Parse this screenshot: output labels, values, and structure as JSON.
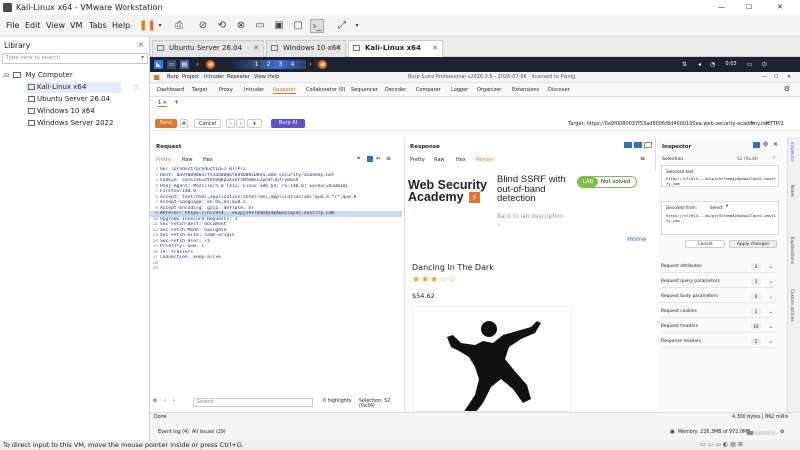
{
  "window": {
    "title": "Kali-Linux x64 - VMware Workstation",
    "minimize": "—",
    "maximize": "☐",
    "close": "✕"
  },
  "menu": [
    "File",
    "Edit",
    "View",
    "VM",
    "Tabs",
    "Help"
  ],
  "library": {
    "title": "Library",
    "close": "✕",
    "search_placeholder": "Type here to search",
    "root": "My Computer",
    "items": [
      "Kali-Linux x64",
      "Ubuntu Server 26.04",
      "Windows 10 x64",
      "Windows Server 2022"
    ]
  },
  "vm_tabs": [
    {
      "label": "Ubuntu Server 26.04"
    },
    {
      "label": "Windows 10 x64"
    },
    {
      "label": "Kali-Linux x64"
    }
  ],
  "kali": {
    "workspaces": [
      "1",
      "2",
      "3",
      "4"
    ],
    "time": "0:03"
  },
  "burp": {
    "title": "Burp Suite Professional v2026.3.5 - 2026-07-06 - licensed to Pwnlg",
    "menu": [
      "Burp",
      "Project",
      "Intruder",
      "Repeater",
      "View",
      "Help"
    ],
    "tabs": [
      "Dashboard",
      "Target",
      "Proxy",
      "Intruder",
      "Repeater",
      "Collaborator (0)",
      "Sequencer",
      "Decoder",
      "Comparer",
      "Logger",
      "Organizer",
      "Extensions",
      "Discover"
    ],
    "subtab": "1 ×",
    "send": "Send",
    "cancel": "Cancel",
    "burpai": "Burp AI",
    "target": "Target: https://0a9f0080037f53ad8006f8d4000100ea.web-security-academy.net",
    "http": "HTTP/2",
    "request": {
      "title": "Request",
      "tabs": [
        "Pretty",
        "Raw",
        "Hex"
      ],
      "lines": [
        "GET /product?productId=1 HTTP/2",
        "Host: 0a9f0080037f53ad8006f8d4000100ea.web-security-academy.net",
        "Cookie: session=4tVX9qKpuXxSt5NtmWsGJpn4t3QTryp6vA",
        "User-Agent: Mozilla/5.0 (X11; Linux x86_64; rv:140.0) Gecko/20100101",
        "Firefox/140.0",
        "Accept: text/html,application/xhtml+xml,application/xml;q=0.9,*/*;q=0.8",
        "Accept-Language: en-US,en;q=0.5",
        "Accept-Encoding: gzip, deflate, br",
        "Referer: https://nlc9l4...ok2pjs9z7dnm4y4pAwuZlqcei.oastify.com",
        "Upgrade-Insecure-Requests: 1",
        "Sec-Fetch-Dest: document",
        "Sec-Fetch-Mode: navigate",
        "Sec-Fetch-Site: same-origin",
        "Sec-Fetch-User: ?1",
        "Priority: u=0, i",
        "Te: trailers",
        "Connection: keep-alive",
        "",
        ""
      ],
      "search_placeholder": "Search",
      "highlights": "0 highlights",
      "selection": "Selection: 52 (0x34)"
    },
    "response": {
      "title": "Response",
      "tabs": [
        "Pretty",
        "Raw",
        "Hex",
        "Render"
      ],
      "wsa_logo": [
        "Web Security",
        "Academy"
      ],
      "lab_title": "Blind SSRF with out-of-band detection",
      "lab_badge": "LAB",
      "lab_status": "Not solved",
      "back_link": "Back to lab description",
      "home": "Home",
      "product_title": "Dancing In The Dark",
      "price": "$54.62",
      "stars": "★★★☆☆"
    },
    "inspector": {
      "title": "Inspector",
      "selection_label": "Selection",
      "selection_count": "52 (0x34)",
      "selected_text_label": "Selected text",
      "selected_text": "https://nlc9l4...ok2pjs9z7dnm4y4pAwuZlqcei.oastify.com",
      "decoded_label": "Decoded from:",
      "decoded_select": "Select",
      "decoded_text": "https://nlc9l4...ok2pjs9z7dnm4y4pAwuZlqcei.oastify.com",
      "cancel": "Cancel",
      "apply": "Apply changes",
      "sections": [
        {
          "label": "Request attributes",
          "count": "2"
        },
        {
          "label": "Request query parameters",
          "count": "1"
        },
        {
          "label": "Request body parameters",
          "count": "0"
        },
        {
          "label": "Request cookies",
          "count": "1"
        },
        {
          "label": "Request headers",
          "count": "16"
        },
        {
          "label": "Response headers",
          "count": "5"
        }
      ],
      "rail": [
        "Inspector",
        "Notes",
        "Explanations",
        "Custom actions"
      ]
    },
    "bottom": {
      "done": "Done",
      "bytes": "4,300 bytes | 862 millis",
      "event_log": "Event log (4)",
      "all_issues": "All issues (29)",
      "memory": "Memory: 226.3MB of 972.0MB"
    }
  },
  "statusbar": "To direct input to this VM, move the mouse pointer inside or press Ctrl+G.",
  "colors": {
    "orange": "#e8742c",
    "purple": "#5b4fd6",
    "green": "#7bc043",
    "selection": "#c8d8f0"
  }
}
